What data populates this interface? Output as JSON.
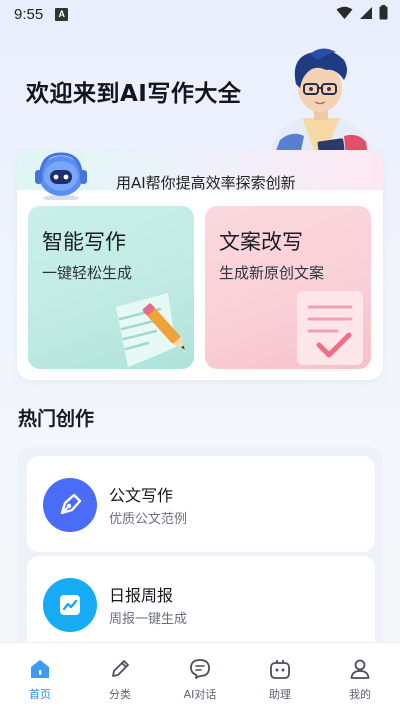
{
  "status_bar": {
    "time": "9:55",
    "notification": "A"
  },
  "hero": {
    "title": "欢迎来到AI写作大全"
  },
  "features": {
    "slogan": "用AI帮你提高效率探索创新",
    "cards": [
      {
        "title": "智能写作",
        "subtitle": "一键轻松生成"
      },
      {
        "title": "文案改写",
        "subtitle": "生成新原创文案"
      }
    ]
  },
  "popular": {
    "title": "热门创作",
    "items": [
      {
        "title": "公文写作",
        "subtitle": "优质公文范例",
        "icon": "pen-nib-icon",
        "color": "#4a6cf7"
      },
      {
        "title": "日报周报",
        "subtitle": "周报一键生成",
        "icon": "trend-chart-icon",
        "color": "#17aaf5"
      }
    ]
  },
  "nav": {
    "items": [
      {
        "label": "首页",
        "icon": "home-icon",
        "active": true
      },
      {
        "label": "分类",
        "icon": "pencil-icon",
        "active": false
      },
      {
        "label": "AI对话",
        "icon": "chat-icon",
        "active": false
      },
      {
        "label": "助理",
        "icon": "robot-icon",
        "active": false
      },
      {
        "label": "我的",
        "icon": "user-icon",
        "active": false
      }
    ]
  },
  "colors": {
    "accent": "#2f8df5",
    "writing_card": "#c9f0e8",
    "rewrite_card": "#fbd9de"
  }
}
